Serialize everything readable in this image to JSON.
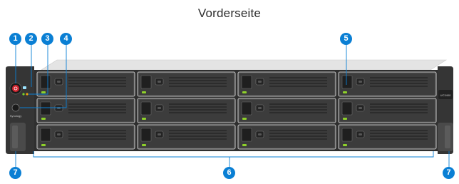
{
  "title": "Vorderseite",
  "model_label": "UC3400",
  "brand": "Synology",
  "callouts": [
    "1",
    "2",
    "3",
    "4",
    "5",
    "6",
    "7"
  ],
  "bay_layout": {
    "rows": 3,
    "columns": 4
  },
  "colors": {
    "callout": "#0a7fd4",
    "chassis": "#2f2f2f",
    "drive_led": "#8ed12a",
    "power_button": "#d0242f"
  }
}
